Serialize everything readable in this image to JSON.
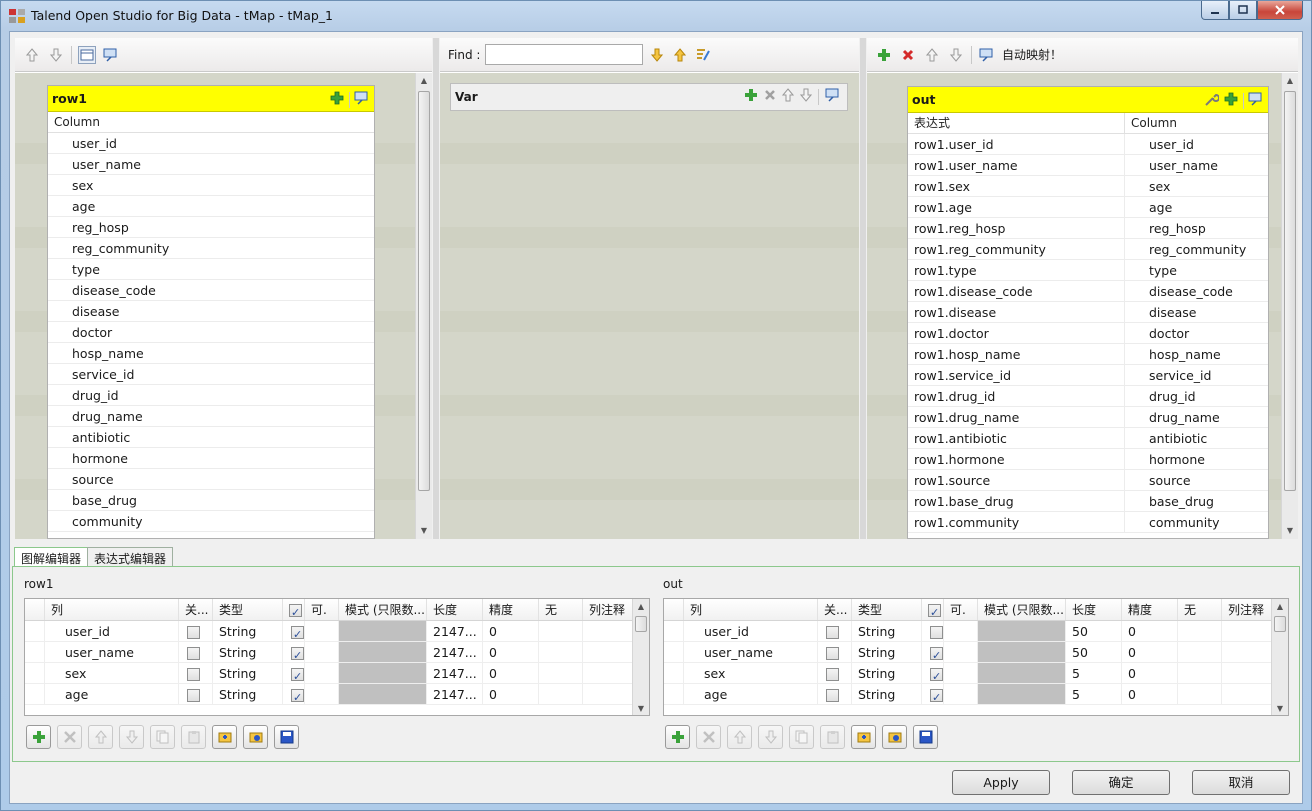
{
  "window": {
    "title": "Talend Open Studio for Big Data - tMap - tMap_1"
  },
  "input_panel": {
    "table_name": "row1",
    "column_header": "Column",
    "columns": [
      "user_id",
      "user_name",
      "sex",
      "age",
      "reg_hosp",
      "reg_community",
      "type",
      "disease_code",
      "disease",
      "doctor",
      "hosp_name",
      "service_id",
      "drug_id",
      "drug_name",
      "antibiotic",
      "hormone",
      "source",
      "base_drug",
      "community"
    ]
  },
  "var_panel": {
    "find_label": "Find :",
    "find_value": "",
    "table_name": "Var"
  },
  "output_panel": {
    "auto_map_label": "自动映射！",
    "table_name": "out",
    "expr_header": "表达式",
    "column_header": "Column",
    "rows": [
      {
        "expr": "row1.user_id",
        "col": "user_id"
      },
      {
        "expr": "row1.user_name",
        "col": "user_name"
      },
      {
        "expr": "row1.sex",
        "col": "sex"
      },
      {
        "expr": "row1.age",
        "col": "age"
      },
      {
        "expr": "row1.reg_hosp",
        "col": "reg_hosp"
      },
      {
        "expr": "row1.reg_community",
        "col": "reg_community"
      },
      {
        "expr": "row1.type",
        "col": "type"
      },
      {
        "expr": "row1.disease_code",
        "col": "disease_code"
      },
      {
        "expr": "row1.disease",
        "col": "disease"
      },
      {
        "expr": "row1.doctor",
        "col": "doctor"
      },
      {
        "expr": "row1.hosp_name",
        "col": "hosp_name"
      },
      {
        "expr": "row1.service_id",
        "col": "service_id"
      },
      {
        "expr": "row1.drug_id",
        "col": "drug_id"
      },
      {
        "expr": "row1.drug_name",
        "col": "drug_name"
      },
      {
        "expr": "row1.antibiotic",
        "col": "antibiotic"
      },
      {
        "expr": "row1.hormone",
        "col": "hormone"
      },
      {
        "expr": "row1.source",
        "col": "source"
      },
      {
        "expr": "row1.base_drug",
        "col": "base_drug"
      },
      {
        "expr": "row1.community",
        "col": "community"
      }
    ]
  },
  "tabs": [
    "图解编辑器",
    "表达式编辑器"
  ],
  "schema_headers": [
    "列",
    "关...",
    "类型",
    "",
    "可.",
    "模式 (只限数...",
    "长度",
    "精度",
    "无",
    "列注释"
  ],
  "schema_left": {
    "title": "row1",
    "rows": [
      {
        "name": "user_id",
        "key": false,
        "type": "String",
        "nullable": true,
        "length": "2147...",
        "precision": "0"
      },
      {
        "name": "user_name",
        "key": false,
        "type": "String",
        "nullable": true,
        "length": "2147...",
        "precision": "0"
      },
      {
        "name": "sex",
        "key": false,
        "type": "String",
        "nullable": true,
        "length": "2147...",
        "precision": "0"
      },
      {
        "name": "age",
        "key": false,
        "type": "String",
        "nullable": true,
        "length": "2147...",
        "precision": "0"
      }
    ]
  },
  "schema_right": {
    "title": "out",
    "rows": [
      {
        "name": "user_id",
        "key": false,
        "type": "String",
        "nullable": false,
        "length": "50",
        "precision": "0"
      },
      {
        "name": "user_name",
        "key": false,
        "type": "String",
        "nullable": true,
        "length": "50",
        "precision": "0"
      },
      {
        "name": "sex",
        "key": false,
        "type": "String",
        "nullable": true,
        "length": "5",
        "precision": "0"
      },
      {
        "name": "age",
        "key": false,
        "type": "String",
        "nullable": true,
        "length": "5",
        "precision": "0"
      }
    ]
  },
  "buttons": {
    "apply": "Apply",
    "ok": "确定",
    "cancel": "取消"
  }
}
